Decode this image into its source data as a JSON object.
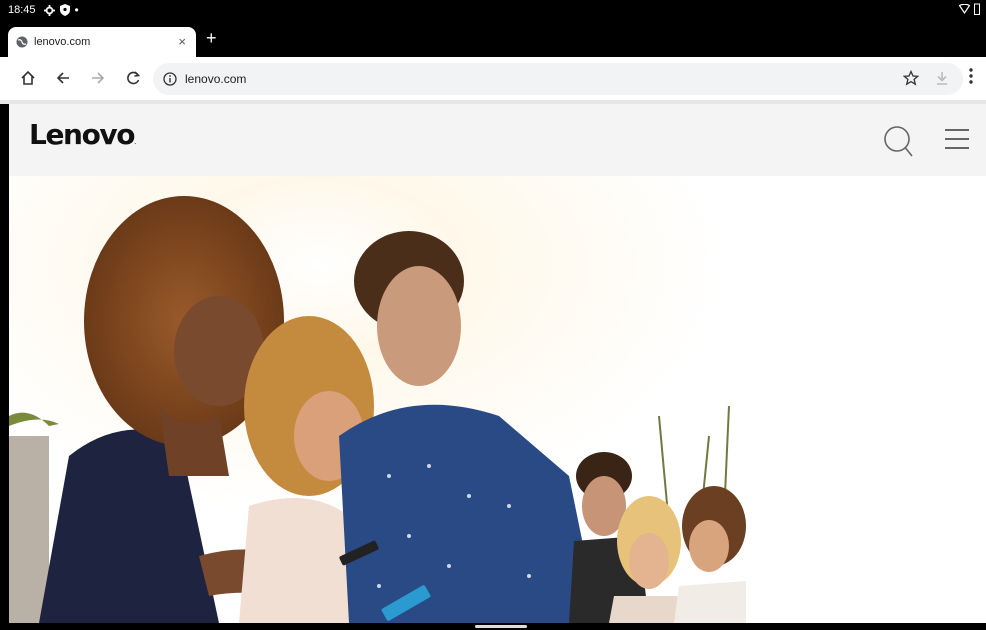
{
  "status_bar": {
    "time": "18:45"
  },
  "tabs": [
    {
      "title": "lenovo.com"
    }
  ],
  "new_tab_label": "+",
  "tab_close_label": "×",
  "omnibox": {
    "url": "lenovo.com"
  },
  "site": {
    "logo_text": "Lenovo",
    "logo_trademark": ".",
    "hero_image": "group of young people smiling and looking at smartphones outdoors in sunlight"
  },
  "colors": {
    "chrome_dark": "#000000",
    "omnibox_bg": "#f1f3f4",
    "site_header_bg": "#f4f4f4"
  },
  "icons": {
    "status": [
      "settings-icon",
      "shield-icon",
      "dot-icon",
      "wifi-icon",
      "battery-icon"
    ],
    "toolbar": [
      "home-icon",
      "back-icon",
      "forward-icon",
      "reload-icon",
      "info-icon",
      "star-icon",
      "download-icon",
      "more-vert-icon"
    ],
    "site": [
      "search-icon",
      "hamburger-menu-icon"
    ]
  }
}
